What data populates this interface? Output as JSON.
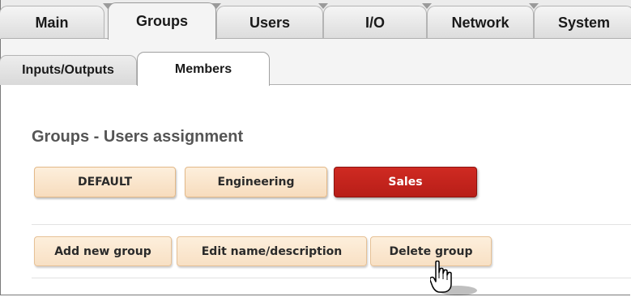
{
  "top_tabs": [
    {
      "label": "Main"
    },
    {
      "label": "Groups"
    },
    {
      "label": "Users"
    },
    {
      "label": "I/O"
    },
    {
      "label": "Network"
    },
    {
      "label": "System"
    }
  ],
  "active_top_tab": "Groups",
  "sub_tabs": [
    {
      "label": "Inputs/Outputs"
    },
    {
      "label": "Members"
    }
  ],
  "active_sub_tab": "Members",
  "section": {
    "title": "Groups - Users assignment"
  },
  "groups": [
    {
      "label": "DEFAULT",
      "selected": false
    },
    {
      "label": "Engineering",
      "selected": false
    },
    {
      "label": "Sales",
      "selected": true
    }
  ],
  "actions": {
    "add_label": "Add new group",
    "edit_label": "Edit name/description",
    "delete_label": "Delete group"
  },
  "cursor_icon": "hand-pointer-icon",
  "colors": {
    "selected_group": "#c6241d",
    "group_button": "#fbe6cc",
    "group_border": "#e3b989"
  }
}
